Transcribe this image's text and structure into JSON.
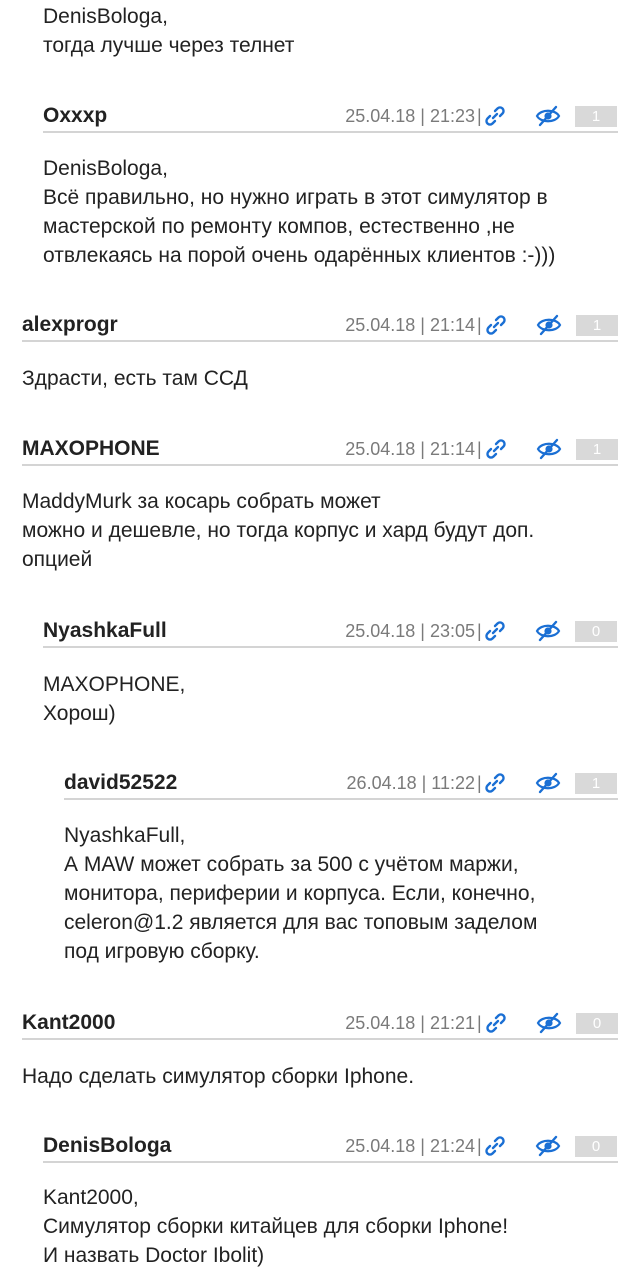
{
  "comments": [
    {
      "body": "DenisBologa,\nтогда лучше через телнет"
    },
    {
      "author": "Oxxxp",
      "date": "25.04.18 | 21:23",
      "sep": "|",
      "rating": "1",
      "body": "DenisBologa,\nВсё правильно, но нужно играть в этот симулятор в\nмастерской по ремонту компов, естественно ,не\nотвлекаясь на порой очень одарённых клиентов :-)))"
    },
    {
      "author": "alexprogr",
      "date": "25.04.18 | 21:14",
      "sep": "|",
      "rating": "1",
      "body": "Здрасти, есть там ССД"
    },
    {
      "author": "MAXOPHONE",
      "date": "25.04.18 | 21:14",
      "sep": "|",
      "rating": "1",
      "body": "MaddyMurk за косарь собрать может\nможно и дешевле, но тогда корпус и хард будут доп.\nопцией"
    },
    {
      "author": "NyashkaFull",
      "date": "25.04.18 | 23:05",
      "sep": "|",
      "rating": "0",
      "body": "MAXOPHONE,\nХорош)"
    },
    {
      "author": "david52522",
      "date": "26.04.18 | 11:22",
      "sep": "|",
      "rating": "1",
      "body": "NyashkaFull,\nА MAW может собрать за 500 с учётом маржи,\nмонитора, периферии и корпуса. Если, конечно,\nceleron@1.2 является для вас топовым заделом\nпод игровую сборку."
    },
    {
      "author": "Kant2000",
      "date": "25.04.18 | 21:21",
      "sep": "|",
      "rating": "0",
      "body": "Надо сделать симулятор сборки Iphone."
    },
    {
      "author": "DenisBologa",
      "date": "25.04.18 | 21:24",
      "sep": "|",
      "rating": "0",
      "body": "Kant2000,\nСимулятор сборки китайцев для сборки Iphone!\nИ назвать Doctor Ibolit)"
    }
  ],
  "icons": {
    "link": "link-icon",
    "hide": "hide-eye-icon"
  },
  "colors": {
    "icon_blue": "#1a6fd4",
    "rating_bg": "#d9d9d9",
    "divider": "#d4d4d4",
    "meta_text": "#7a7a7a"
  }
}
